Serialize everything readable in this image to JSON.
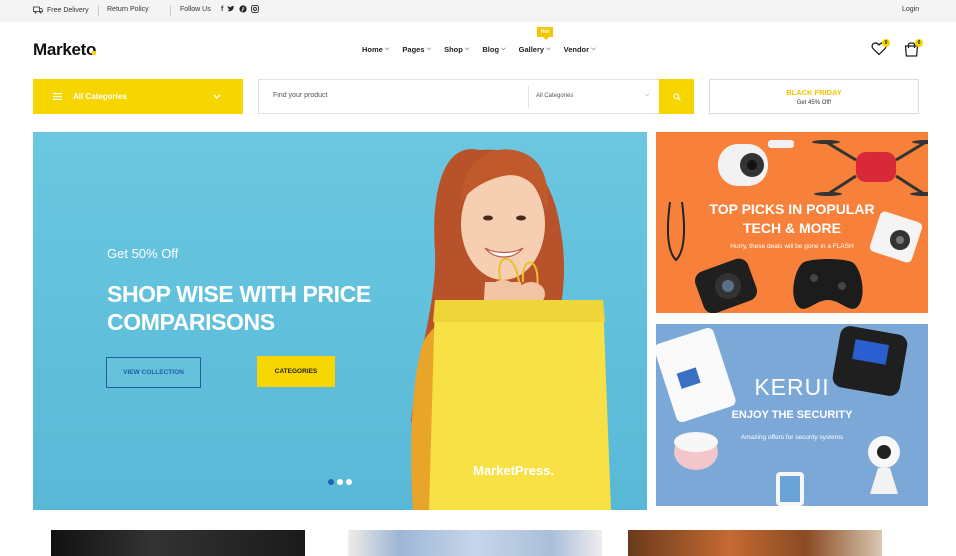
{
  "topbar": {
    "free_delivery": "Free Delivery",
    "return_policy": "Return Policy",
    "follow_us": "Follow Us",
    "social": [
      "f",
      "♥",
      "P",
      "◎"
    ],
    "login": "Login"
  },
  "header": {
    "logo": "Marketo",
    "nav": [
      {
        "label": "Home"
      },
      {
        "label": "Pages"
      },
      {
        "label": "Shop"
      },
      {
        "label": "Blog"
      },
      {
        "label": "Gallery"
      },
      {
        "label": "Vendor"
      }
    ],
    "hot_badge": "Hot",
    "wishlist_count": "0",
    "cart_count": "0"
  },
  "category_menu": {
    "label": "All Categories"
  },
  "search": {
    "placeholder": "Find your product",
    "category_select": "All Categories"
  },
  "promo": {
    "title": "BLACK FRIDAY",
    "subtitle": "Get 45% Off!"
  },
  "hero": {
    "subtitle": "Get 50% Off",
    "headline_line1": "SHOP WISE WITH PRICE",
    "headline_line2": "COMPARISONS",
    "button_outline": "VIEW COLLECTION",
    "button_solid": "CATEGORIES",
    "bag_text": "MarketPress.",
    "slide_count": 3,
    "active_slide": 1
  },
  "banner_tech": {
    "title_line1": "TOP PICKS IN POPULAR",
    "title_line2": "TECH & MORE",
    "subtitle": "Hurry, these deals will be gone in a FLASH"
  },
  "banner_security": {
    "brand": "KERUI",
    "title": "ENJOY THE SECURITY",
    "subtitle": "Amazing offers for security systems"
  },
  "colors": {
    "accent": "#f7d500",
    "hero_bg": "#5fbfdb",
    "banner_orange": "#f7813a",
    "banner_blue": "#7ba8d6",
    "link_blue": "#1d5fa6"
  },
  "icons": [
    "truck-icon",
    "return-icon",
    "facebook-icon",
    "twitter-icon",
    "pinterest-icon",
    "instagram-icon",
    "heart-icon",
    "cart-icon",
    "menu-icon",
    "chevron-down-icon",
    "search-icon"
  ]
}
